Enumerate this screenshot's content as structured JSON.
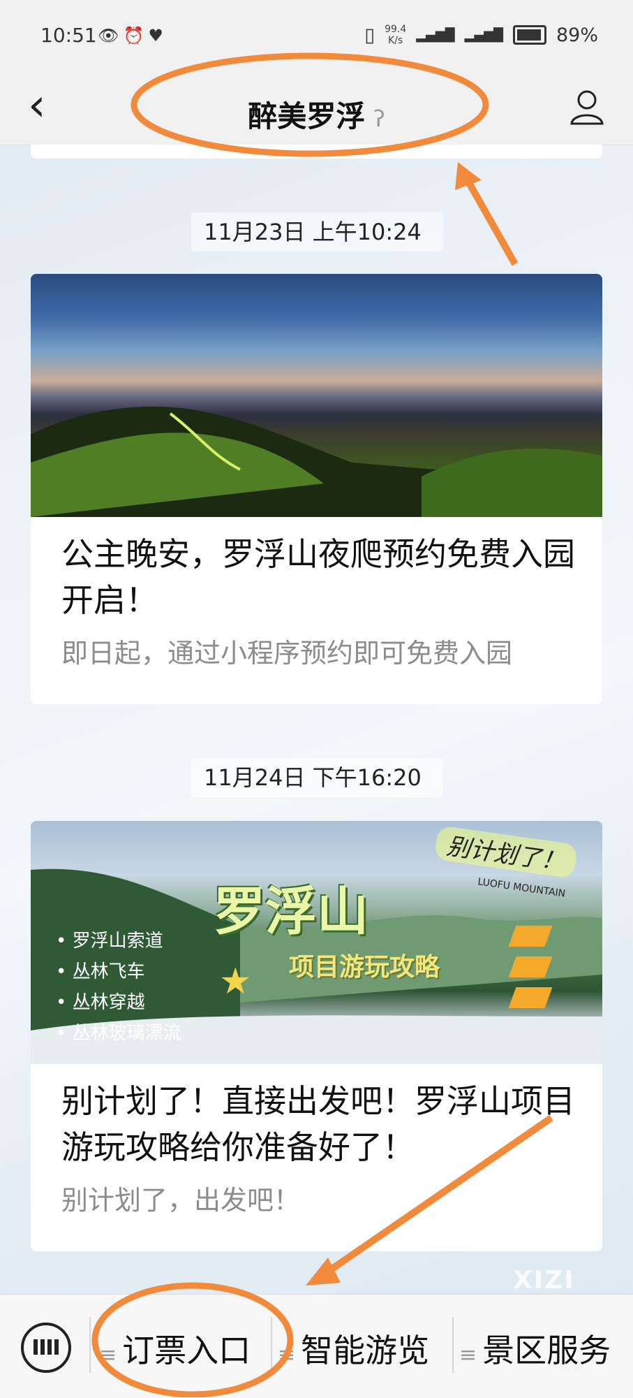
{
  "status_bar": {
    "time": "10:51",
    "speed": "99.4",
    "speed_unit": "K/s",
    "battery": "89%"
  },
  "header": {
    "title": "醉美罗浮"
  },
  "feed": [
    {
      "timestamp": "11月23日 上午10:24",
      "title": "公主晚安，罗浮山夜爬预约免费入园开启！",
      "desc": "即日起，通过小程序预约即可免费入园"
    },
    {
      "timestamp": "11月24日 下午16:20",
      "title": "别计划了！直接出发吧！罗浮山项目游玩攻略给你准备好了！",
      "desc": "别计划了，出发吧！",
      "poster": {
        "title": "罗浮山",
        "subtitle": "项目游玩攻略",
        "tag": "别计划了！",
        "tag_en": "LUOFU MOUNTAIN",
        "items": [
          "罗浮山索道",
          "丛林飞车",
          "丛林穿越",
          "丛林玻璃漂流"
        ]
      }
    }
  ],
  "menu": {
    "items": [
      "订票入口",
      "智能游览",
      "景区服务"
    ]
  },
  "watermark": "XIZI",
  "colors": {
    "annotation": "#f28a3c",
    "background": "#eef3f7"
  }
}
